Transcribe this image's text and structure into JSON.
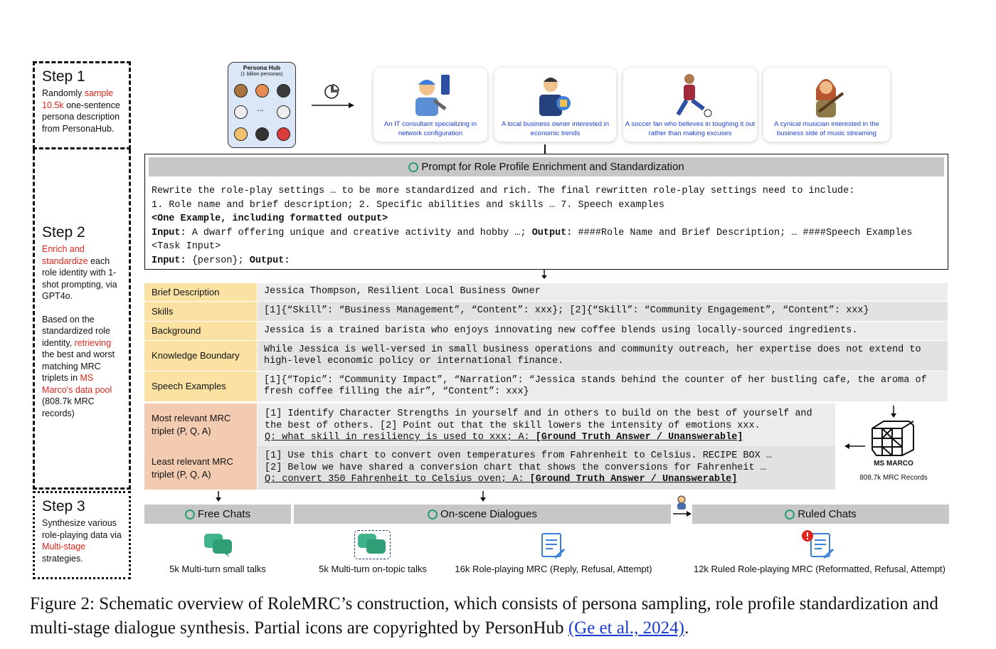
{
  "steps": {
    "step1": {
      "title": "Step 1",
      "pre": "Randomly ",
      "red": "sample 10.5k",
      "post": " one-sentence persona description from PersonaHub."
    },
    "step2": {
      "title": "Step 2",
      "p1_red": "Enrich and standardize",
      "p1_post": " each role identity with 1-shot prompting, via GPT4o.",
      "p2_pre": "Based on the standardized role identity, ",
      "p2_red1": "retrieving",
      "p2_mid": " the best and worst matching MRC triplets in ",
      "p2_red2": "MS Marco's data pool",
      "p2_post": " (808.7k MRC records)"
    },
    "step3": {
      "title": "Step 3",
      "pre": "Synthesize various role-playing data via ",
      "red": "Multi-stage",
      "post": " strategies."
    }
  },
  "persona_hub": {
    "title": "Persona Hub",
    "subtitle": "(1 billion personas)",
    "dots": "..."
  },
  "personas": [
    {
      "label": "An IT consultant specializing in network configuration",
      "icon": "it-consultant-icon"
    },
    {
      "label": "A local business owner interested in economic trends",
      "icon": "business-owner-icon"
    },
    {
      "label": "A soccer fan who believes in toughing it out rather than making excuses",
      "icon": "soccer-fan-icon"
    },
    {
      "label": "A cynical musician interested in the business side of music streaming",
      "icon": "musician-icon"
    }
  ],
  "prompt": {
    "title": "Prompt for Role Profile Enrichment and Standardization",
    "line1": "Rewrite the role-play settings … to be more standardized and rich. The final rewritten role-play settings need to include:",
    "line2": "1. Role name and brief description; 2. Specific abilities and skills … 7. Speech examples",
    "line3": "<One Example, including formatted output>",
    "line4_k1": "Input:",
    "line4_v1": " A dwarf offering unique and creative activity and hobby …; ",
    "line4_k2": "Output:",
    "line4_v2": " ####Role Name and Brief Description; … ####Speech Examples",
    "line5": "<Task Input>",
    "line6_k1": "Input:",
    "line6_v1": " {person}; ",
    "line6_k2": "Output:"
  },
  "profile_rows": [
    {
      "label": "Brief Description",
      "value": "Jessica Thompson, Resilient Local Business Owner"
    },
    {
      "label": "Skills",
      "value": "[1]{“Skill”: “Business Management”, “Content”: xxx}; [2]{“Skill”: “Community Engagement”, “Content”: xxx}"
    },
    {
      "label": "Background",
      "value": "Jessica is a trained barista who enjoys innovating new coffee blends using locally-sourced ingredients."
    },
    {
      "label": "Knowledge Boundary",
      "value": "While Jessica is well-versed in small business operations and community outreach, her expertise does not extend to high-level economic policy or international finance."
    },
    {
      "label": "Speech Examples",
      "value": "[1]{“Topic”: “Community Impact”, “Narration”: “Jessica stands behind the counter of her bustling cafe, the aroma of fresh coffee filling the air”, “Content”: xxx}"
    }
  ],
  "mrc_rows": [
    {
      "label": "Most relevant MRC triplet (P, Q, A)",
      "line1": "[1] Identify Character Strengths in yourself and in others to build on the best of yourself and",
      "line2": "the best of others. [2] Point out that the skill lowers the intensity of emotions xxx.",
      "q_pre": "Q: what skill in resiliency is used to xxx; A: ",
      "q_bold": "[Ground Truth Answer / Unanswerable]"
    },
    {
      "label": "Least relevant MRC triplet (P, Q, A)",
      "line1": "[1] Use this chart to convert oven temperatures from Fahrenheit to Celsius. RECIPE BOX …",
      "line2": "[2] Below we have shared a conversion chart that shows the conversions for Fahrenheit …",
      "q_pre": "Q: convert 350 Fahrenheit to Celsius oven; A: ",
      "q_bold": "[Ground Truth Answer / Unanswerable]"
    }
  ],
  "ms_marco": {
    "title": "MS MARCO",
    "subtitle": "808.7k MRC Records"
  },
  "stage_bars": [
    "Free Chats",
    "On-scene Dialogues",
    "Ruled Chats"
  ],
  "data_items": [
    "5k Multi-turn small talks",
    "5k Multi-turn on-topic talks",
    "16k Role-playing MRC (Reply, Refusal, Attempt)",
    "12k Ruled Role-playing MRC (Reformatted, Refusal, Attempt)"
  ],
  "caption": {
    "text": "Figure 2: Schematic overview of RoleMRC’s construction, which consists of persona sampling, role profile standardization and multi-stage dialogue synthesis. Partial icons are copyrighted by PersonHub ",
    "cite": "(Ge et al., 2024)",
    "end": "."
  }
}
